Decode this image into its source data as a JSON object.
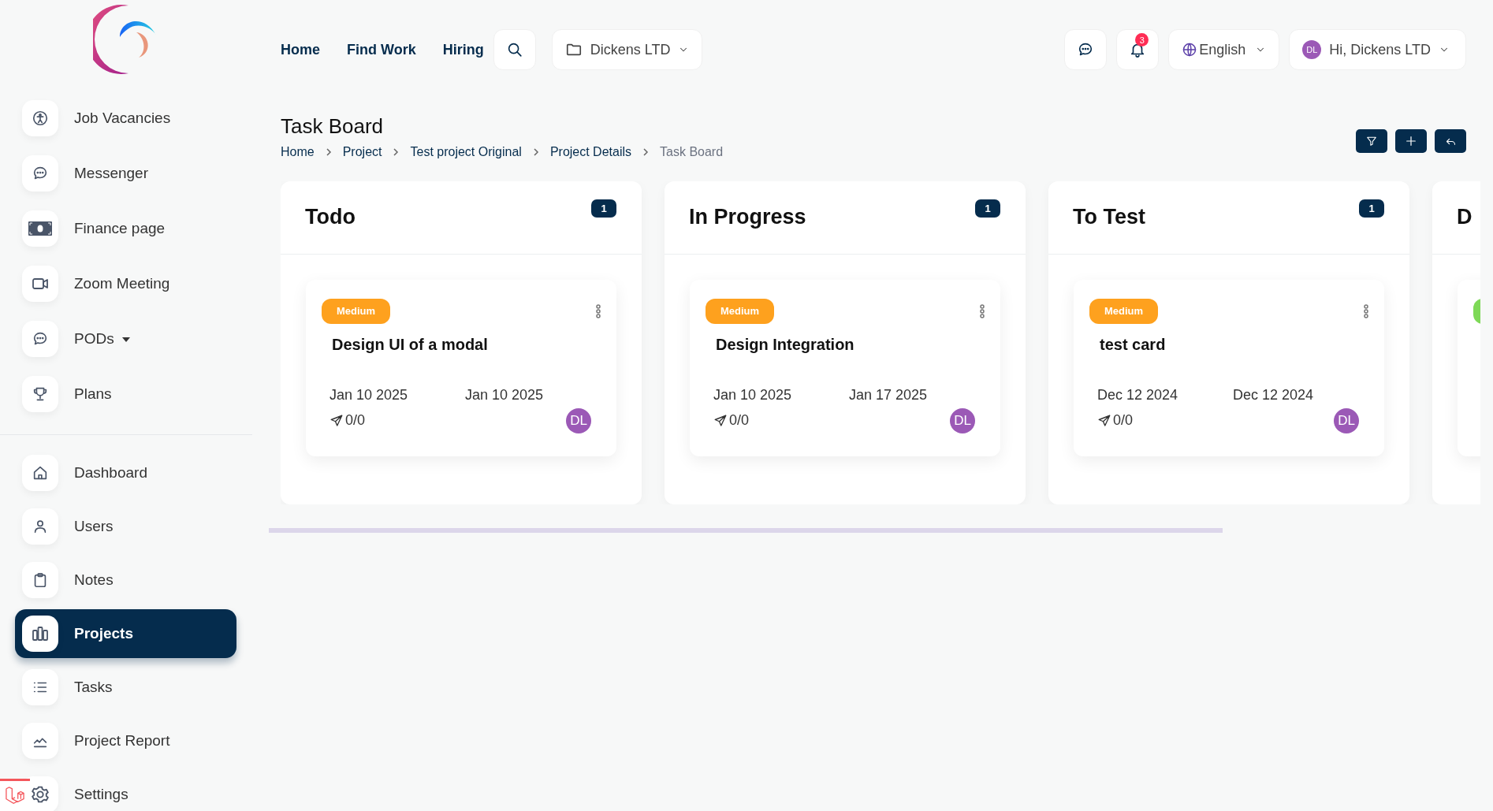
{
  "sidebar": {
    "top_items": [
      {
        "label": "Job Vacancies",
        "kind": "accessibility",
        "dropdown": false,
        "selected": false
      },
      {
        "label": "Messenger",
        "kind": "chat",
        "dropdown": false,
        "selected": false
      },
      {
        "label": "Finance page",
        "kind": "money",
        "dropdown": false,
        "selected": false
      },
      {
        "label": "Zoom Meeting",
        "kind": "video",
        "dropdown": false,
        "selected": false
      },
      {
        "label": "PODs",
        "kind": "chat",
        "dropdown": true,
        "selected": false
      },
      {
        "label": "Plans",
        "kind": "trophy",
        "dropdown": false,
        "selected": false
      }
    ],
    "bottom_items": [
      {
        "label": "Dashboard",
        "kind": "home",
        "dropdown": false,
        "selected": false
      },
      {
        "label": "Users",
        "kind": "user",
        "dropdown": false,
        "selected": false
      },
      {
        "label": "Notes",
        "kind": "clipboard",
        "dropdown": false,
        "selected": false
      },
      {
        "label": "Projects",
        "kind": "columns",
        "dropdown": false,
        "selected": true
      },
      {
        "label": "Tasks",
        "kind": "list",
        "dropdown": false,
        "selected": false
      },
      {
        "label": "Project Report",
        "kind": "chart",
        "dropdown": false,
        "selected": false
      },
      {
        "label": "Settings",
        "kind": "gear",
        "dropdown": false,
        "selected": false
      }
    ]
  },
  "nav": {
    "links": [
      "Home",
      "Find Work",
      "Hiring"
    ],
    "workspace": "Dickens LTD",
    "notification_count": "3",
    "language": "English",
    "user": {
      "initials": "DL",
      "greeting": "Hi, Dickens LTD"
    }
  },
  "page": {
    "title": "Task Board",
    "breadcrumbs": [
      {
        "label": "Home",
        "current": false
      },
      {
        "label": "Project",
        "current": false
      },
      {
        "label": "Test project Original",
        "current": false
      },
      {
        "label": "Project Details",
        "current": false
      },
      {
        "label": "Task Board",
        "current": true
      }
    ]
  },
  "columns": [
    {
      "title": "Todo",
      "count": "1",
      "cards": [
        {
          "priority": "Medium",
          "color": "#fea11e",
          "title": "Design UI of a modal",
          "start_date": "Jan 10 2025",
          "end_date": "Jan 10 2025",
          "progress": "0/0",
          "assignee": "DL"
        }
      ]
    },
    {
      "title": "In Progress",
      "count": "1",
      "cards": [
        {
          "priority": "Medium",
          "color": "#fea11e",
          "title": "Design Integration",
          "start_date": "Jan 10 2025",
          "end_date": "Jan 17 2025",
          "progress": "0/0",
          "assignee": "DL"
        }
      ]
    },
    {
      "title": "To Test",
      "count": "1",
      "cards": [
        {
          "priority": "Medium",
          "color": "#fea11e",
          "title": "test card",
          "start_date": "Dec 12 2024",
          "end_date": "Dec 12 2024",
          "progress": "0/0",
          "assignee": "DL"
        }
      ]
    },
    {
      "title": "D",
      "cards": [
        {
          "color": "#7ed957"
        }
      ]
    }
  ]
}
